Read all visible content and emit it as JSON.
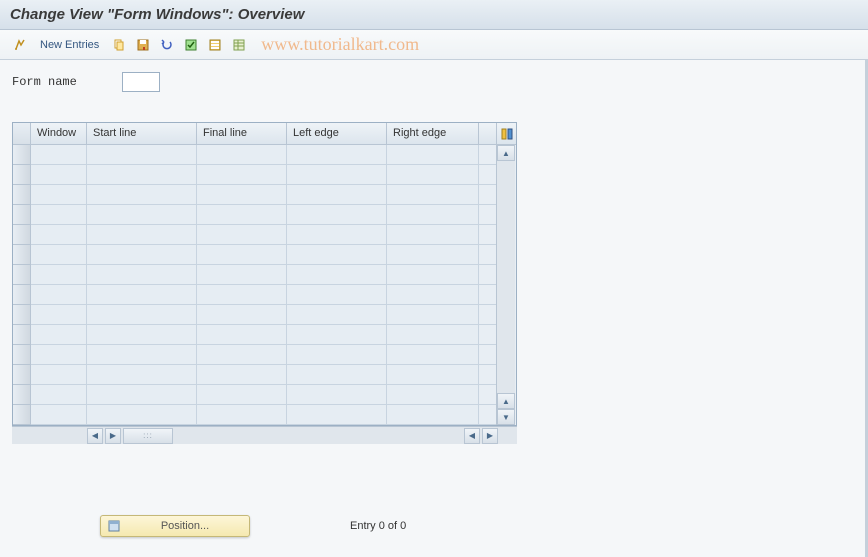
{
  "title": "Change View \"Form Windows\": Overview",
  "toolbar": {
    "new_entries": "New Entries"
  },
  "watermark": "www.tutorialkart.com",
  "form": {
    "name_label": "Form name",
    "name_value": ""
  },
  "table": {
    "columns": [
      "Window",
      "Start line",
      "Final line",
      "Left edge",
      "Right edge"
    ],
    "row_count": 14
  },
  "footer": {
    "position_label": "Position...",
    "entry_text": "Entry 0 of 0"
  }
}
